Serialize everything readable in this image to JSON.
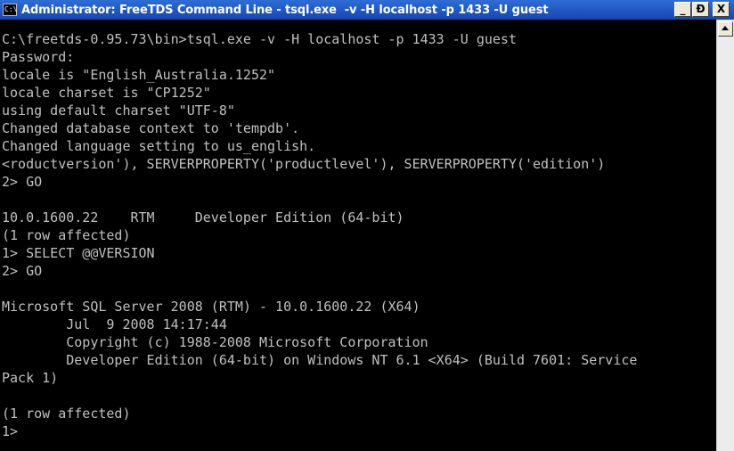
{
  "window": {
    "title": "Administrator: FreeTDS Command Line - tsql.exe  -v -H localhost -p 1433 -U guest",
    "icon": "C:\\",
    "controls": {
      "minimize": "_",
      "maximize": "Ɖ",
      "close": "X"
    }
  },
  "console": {
    "lines": [
      "",
      "C:\\freetds-0.95.73\\bin>tsql.exe -v -H localhost -p 1433 -U guest",
      "Password:",
      "locale is \"English_Australia.1252\"",
      "locale charset is \"CP1252\"",
      "using default charset \"UTF-8\"",
      "Changed database context to 'tempdb'.",
      "Changed language setting to us_english.",
      "<roductversion'), SERVERPROPERTY('productlevel'), SERVERPROPERTY('edition')",
      "2> GO",
      "",
      "10.0.1600.22    RTM     Developer Edition (64-bit)",
      "(1 row affected)",
      "1> SELECT @@VERSION",
      "2> GO",
      "",
      "Microsoft SQL Server 2008 (RTM) - 10.0.1600.22 (X64)",
      "        Jul  9 2008 14:17:44",
      "        Copyright (c) 1988-2008 Microsoft Corporation",
      "        Developer Edition (64-bit) on Windows NT 6.1 <X64> (Build 7601: Service",
      "Pack 1)",
      "",
      "(1 row affected)",
      "1>"
    ]
  }
}
